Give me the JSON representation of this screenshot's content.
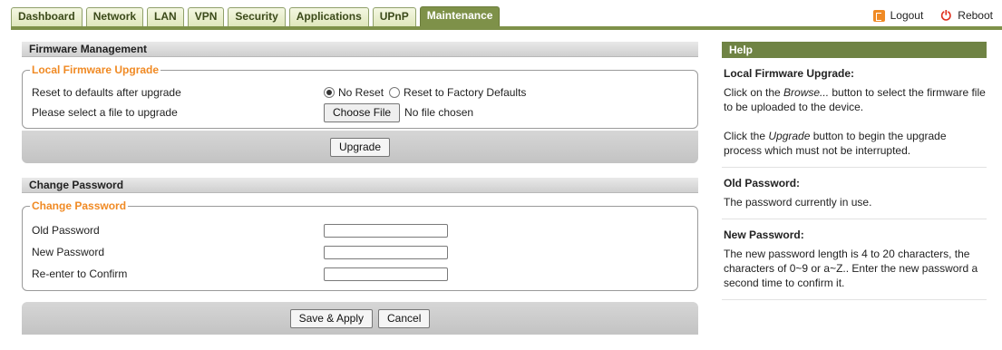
{
  "nav": {
    "tabs": [
      {
        "label": "Dashboard"
      },
      {
        "label": "Network"
      },
      {
        "label": "LAN"
      },
      {
        "label": "VPN"
      },
      {
        "label": "Security"
      },
      {
        "label": "Applications"
      },
      {
        "label": "UPnP"
      },
      {
        "label": "Maintenance",
        "active": true
      }
    ],
    "logout_label": "Logout",
    "reboot_label": "Reboot"
  },
  "firmware": {
    "section_title": "Firmware Management",
    "legend": "Local Firmware Upgrade",
    "reset_label": "Reset to defaults after upgrade",
    "radio_no_reset": "No Reset",
    "radio_factory": "Reset to Factory Defaults",
    "selected_option": "No Reset",
    "file_label": "Please select a file to upgrade",
    "choose_file_label": "Choose File",
    "no_file_text": "No file chosen",
    "upgrade_label": "Upgrade"
  },
  "password": {
    "section_title": "Change Password",
    "legend": "Change Password",
    "old_label": "Old Password",
    "new_label": "New Password",
    "confirm_label": "Re-enter to Confirm",
    "old_value": "",
    "new_value": "",
    "confirm_value": "",
    "save_label": "Save & Apply",
    "cancel_label": "Cancel"
  },
  "help": {
    "title": "Help",
    "items": [
      {
        "title": "Local Firmware Upgrade:",
        "p1_before": "Click on the ",
        "p1_em": "Browse...",
        "p1_after": " button to select the firmware file to be uploaded to the device.",
        "p2_before": "Click the ",
        "p2_em": "Upgrade",
        "p2_after": " button to begin the upgrade process which must not be interrupted."
      },
      {
        "title": "Old Password:",
        "text": "The password currently in use."
      },
      {
        "title": "New Password:",
        "text": "The new password length is 4 to 20 characters, the characters of 0~9 or a~Z.. Enter the new password a second time to confirm it."
      }
    ]
  },
  "colors": {
    "accent_green": "#7e9149",
    "legend_orange": "#f08a24",
    "reboot_red": "#e0301e"
  }
}
